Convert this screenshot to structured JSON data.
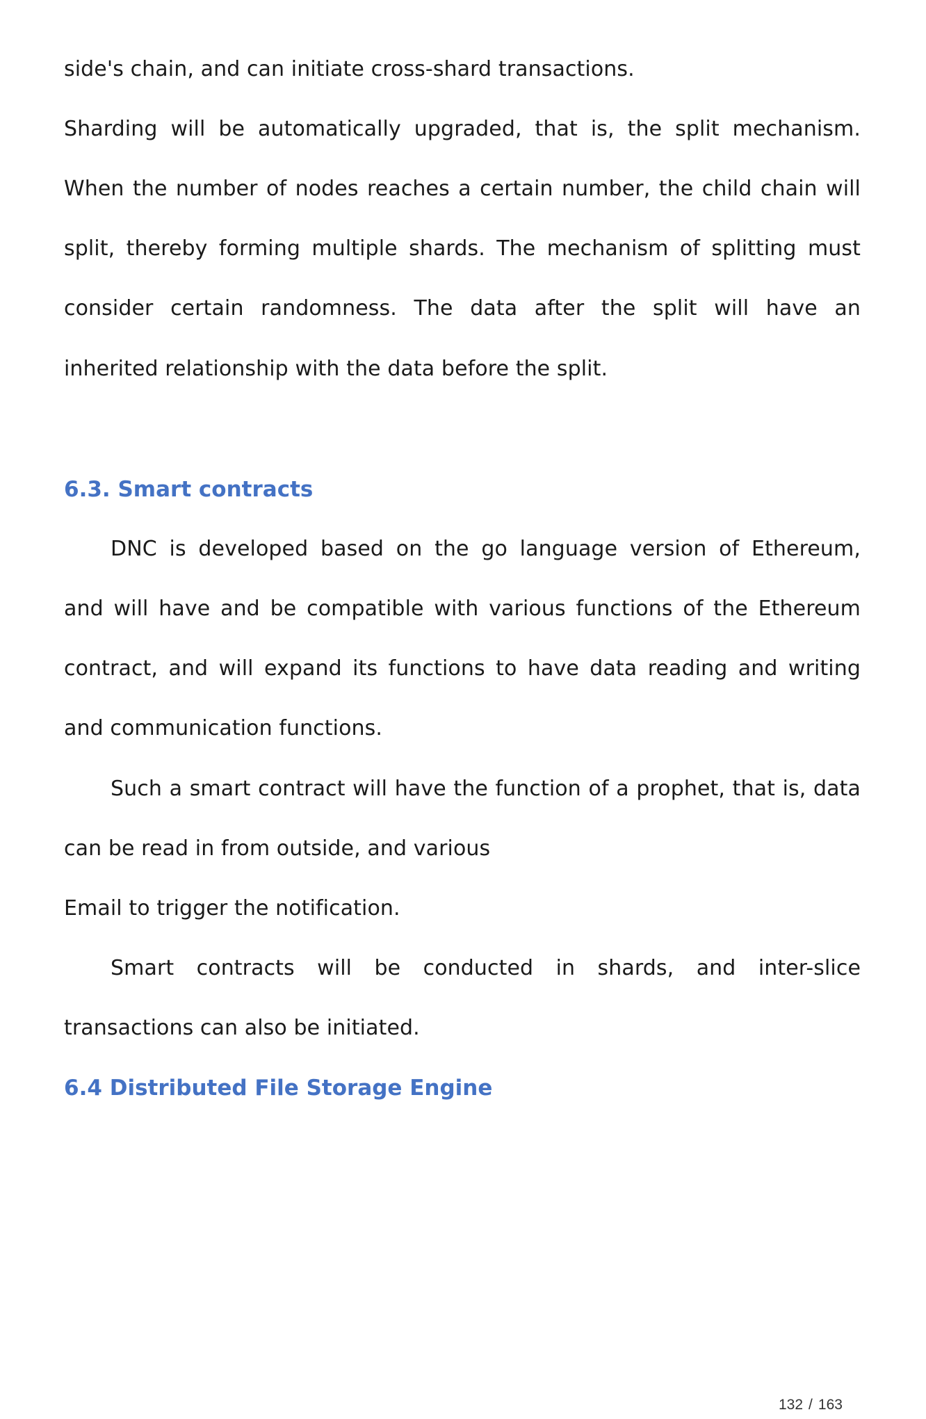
{
  "paragraphs": {
    "p1_line1": "side's chain, and can initiate cross-shard transactions.",
    "p2_line1": "Sharding will be automatically upgraded, that is, the split mechanism.",
    "p2_line2": "When the number of nodes reaches a certain number, the child chain will",
    "p2_line3": "split, thereby forming multiple shards. The mechanism of splitting must",
    "p2_line4": "consider certain randomness. The data after the split will have an",
    "p2_line5": "inherited relationship with the data before the split.",
    "p3_line1": "DNC is developed based on the go language version of Ethereum,",
    "p3_line2": "and will have and be compatible with various functions of the Ethereum",
    "p3_line3": "contract, and will expand its functions to have data reading and writing",
    "p3_line4": "and communication functions.",
    "p4_line1": "Such a smart contract will have the function of a prophet, that is, data",
    "p4_line2": "can be read in from outside, and various",
    "p4_line3": "Email to trigger the notification.",
    "p5_line1": "Smart contracts will be conducted in shards, and inter-slice",
    "p5_line2": "transactions can also be initiated."
  },
  "headings": {
    "section_6_3": "6.3. Smart contracts",
    "section_6_4": "6.4 Distributed File Storage Engine"
  },
  "footer": {
    "current_page": "132",
    "separator": "/",
    "total_pages": "163"
  },
  "colors": {
    "heading": "#4472c4",
    "body_text": "#1a1a1a"
  }
}
